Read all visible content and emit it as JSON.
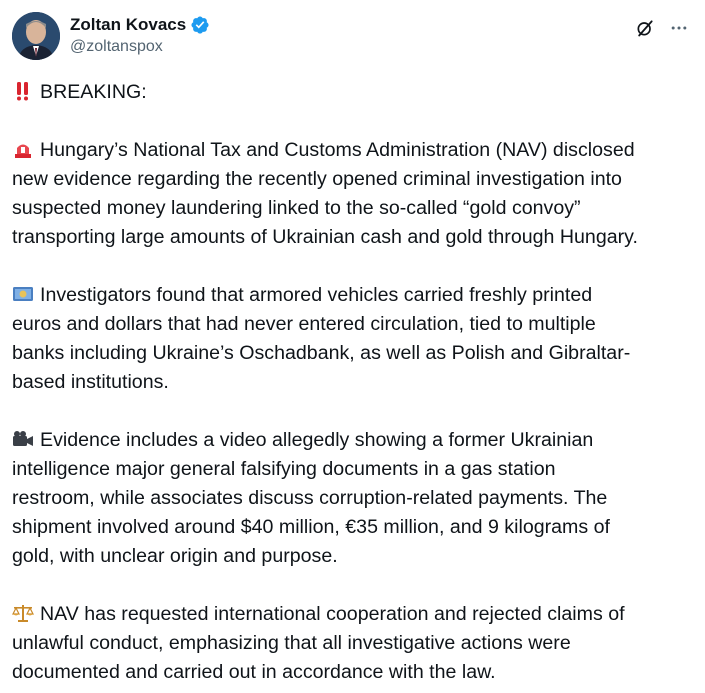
{
  "author": {
    "display_name": "Zoltan Kovacs",
    "handle": "@zoltanspox",
    "verified": true,
    "verified_color": "#1d9bf0"
  },
  "actions": {
    "grok_icon": "grok-icon",
    "more_icon": "more-icon"
  },
  "post": {
    "heading": "BREAKING:",
    "paragraphs": [
      {
        "emoji": "rotating-light-icon",
        "lines": [
          "Hungary’s National Tax and Customs Administration (NAV) disclosed",
          "new evidence regarding the recently opened criminal investigation into",
          "suspected money laundering linked to the so-called “gold convoy”",
          "transporting large amounts of Ukrainian cash and gold through Hungary."
        ]
      },
      {
        "emoji": "euro-banknote-icon",
        "lines": [
          "Investigators found that armored vehicles carried freshly printed",
          "euros and dollars that had never entered circulation, tied to multiple",
          "banks including Ukraine’s Oschadbank, as well as Polish and Gibraltar-",
          "based institutions."
        ]
      },
      {
        "emoji": "video-camera-icon",
        "lines": [
          "Evidence includes a video allegedly showing a former Ukrainian",
          "intelligence major general falsifying documents in a gas station",
          "restroom, while associates discuss corruption-related payments. The",
          "shipment involved around $40 million, €35 million, and 9 kilograms of",
          "gold, with unclear origin and purpose."
        ]
      },
      {
        "emoji": "balance-scale-icon",
        "lines": [
          "NAV has requested international cooperation and rejected claims of",
          "unlawful conduct, emphasizing that all investigative actions were",
          "documented and carried out in accordance with the law."
        ]
      }
    ]
  }
}
